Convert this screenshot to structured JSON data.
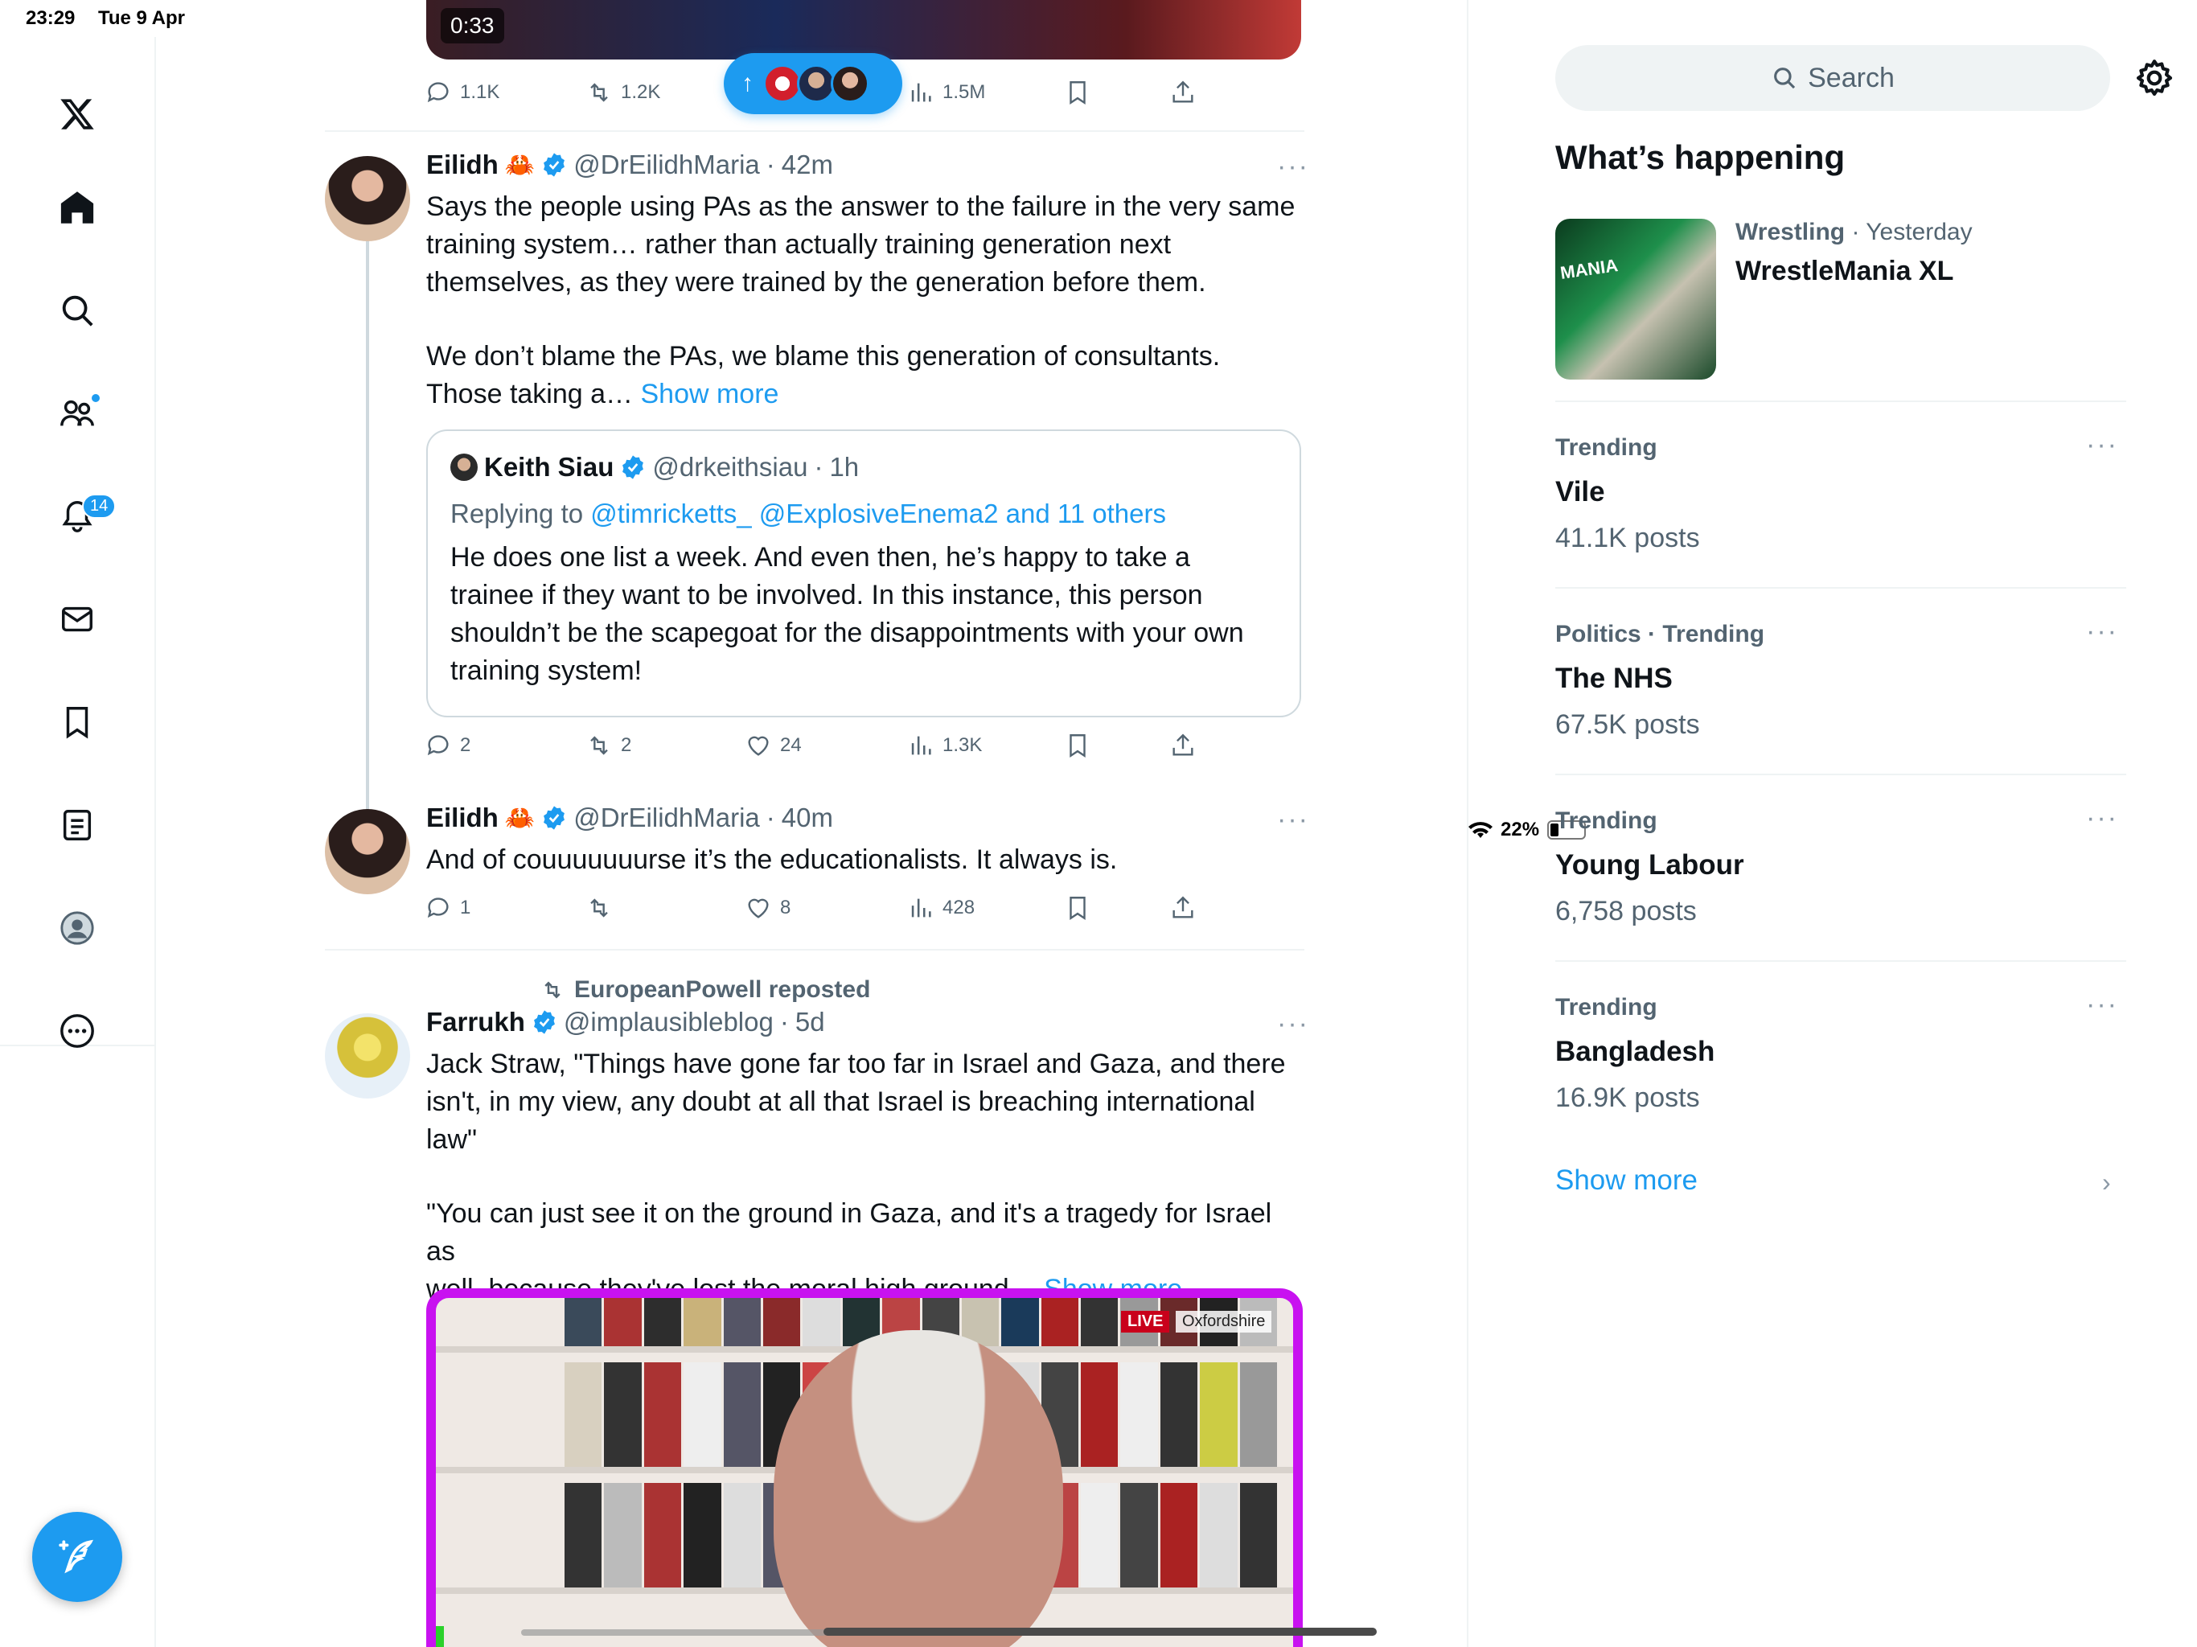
{
  "status_bar": {
    "time": "23:29",
    "date": "Tue 9 Apr",
    "battery": "22%"
  },
  "nav": {
    "notification_count": "14"
  },
  "top_video": {
    "duration": "0:33",
    "replies": "1.1K",
    "reposts": "1.2K",
    "views": "1.5M"
  },
  "tweets": [
    {
      "name": "Eilidh",
      "handle": "@DrEilidhMaria",
      "sep": "·",
      "time": "42m",
      "text_lines": [
        "Says the people using PAs as the answer to the failure in the very same",
        "training system… rather than actually training generation next",
        "themselves, as they were trained by the generation before them."
      ],
      "text_lines_2": [
        "We don’t blame the PAs, we blame this generation of consultants.",
        "Those taking a…"
      ],
      "show_more": "Show more",
      "quote": {
        "name": "Keith Siau",
        "handle": "@drkeithsiau",
        "sep": "·",
        "time": "1h",
        "replying_prefix": "Replying to",
        "replying_to": "@timricketts_ @ExplosiveEnema2 and 11 others",
        "text_lines": [
          "He does one list a week. And even then, he’s happy to take a",
          "trainee if they want to be involved. In this instance, this person",
          "shouldn’t be the scapegoat for the disappointments with your own",
          "training system!"
        ]
      },
      "replies": "2",
      "reposts": "2",
      "likes": "24",
      "views": "1.3K"
    },
    {
      "name": "Eilidh",
      "handle": "@DrEilidhMaria",
      "sep": "·",
      "time": "40m",
      "text": "And of couuuuuuurse it’s the educationalists. It always is.",
      "replies": "1",
      "reposts": "",
      "likes": "8",
      "views": "428"
    },
    {
      "repost_by": "EuropeanPowell reposted",
      "name": "Farrukh",
      "handle": "@implausibleblog",
      "sep": "·",
      "time": "5d",
      "text_lines": [
        "Jack Straw,  \"Things have gone far too far in Israel and Gaza, and there",
        "isn't, in my view, any doubt at all that Israel is breaching international",
        "law\""
      ],
      "text_lines_2": [
        "\"You can just see it on the ground in Gaza, and it's a tragedy for Israel as",
        "well, because they've lost the moral high ground…"
      ],
      "show_more": "Show more",
      "media": {
        "live": "LIVE",
        "location": "Oxfordshire"
      }
    }
  ],
  "sidebar": {
    "search_placeholder": "Search",
    "section_title": "What’s happening",
    "featured": {
      "category": "Wrestling",
      "sep": "·",
      "when": "Yesterday",
      "title": "WrestleMania XL",
      "thumb_text": "MANIA"
    },
    "trends": [
      {
        "category": "Trending",
        "name": "Vile",
        "count": "41.1K posts"
      },
      {
        "category": "Politics · Trending",
        "name": "The NHS",
        "count": "67.5K posts"
      },
      {
        "category": "Trending",
        "name": "Young Labour",
        "count": "6,758 posts"
      },
      {
        "category": "Trending",
        "name": "Bangladesh",
        "count": "16.9K posts"
      }
    ],
    "show_more": "Show more"
  },
  "colors": {
    "accent": "#1d9bf0",
    "media_border": "#c812f0",
    "live_red": "#c9001b"
  }
}
